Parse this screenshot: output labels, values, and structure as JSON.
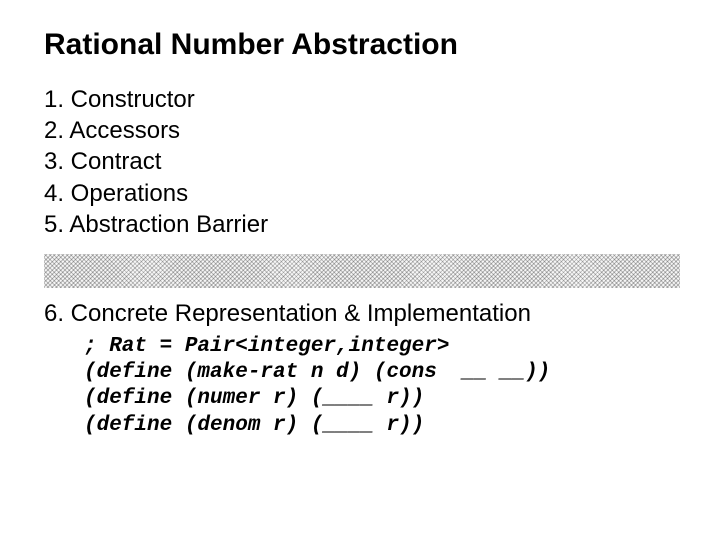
{
  "title": "Rational Number Abstraction",
  "items": [
    "1. Constructor",
    "2. Accessors",
    "3. Contract",
    "4. Operations",
    "5. Abstraction Barrier"
  ],
  "impl_heading": "6. Concrete Representation & Implementation",
  "code_lines": [
    "; Rat = Pair<integer,integer>",
    "(define (make-rat n d) (cons  __ __))",
    "(define (numer r) (____ r))",
    "(define (denom r) (____ r))"
  ]
}
